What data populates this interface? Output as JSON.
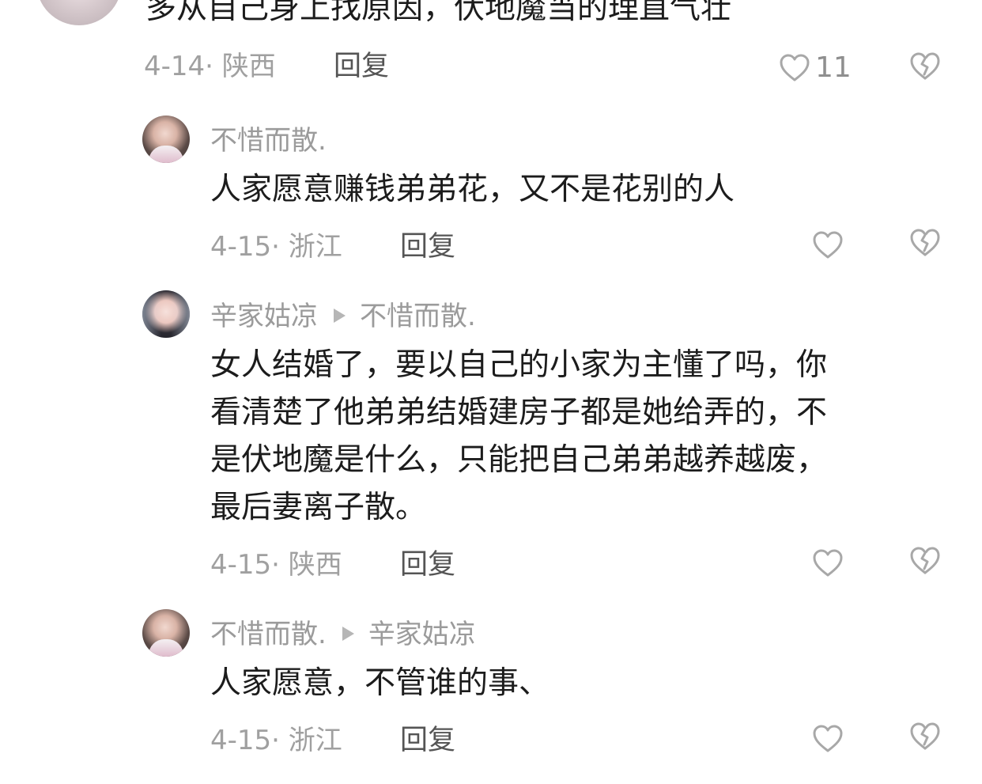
{
  "colors": {
    "primary_text": "#1c1c1c",
    "username": "#9b9b9b",
    "meta": "#a0a0a0",
    "reply": "#555555",
    "icon": "#a8a8a8"
  },
  "top_comment": {
    "text": "多从自己身上找原因，伏地魔当的理直气壮",
    "date": "4-14",
    "location": "陕西",
    "reply_label": "回复",
    "like_count": "11",
    "like_icon": "heart-outline-icon",
    "dislike_icon": "broken-heart-icon"
  },
  "replies": [
    {
      "author": "不惜而散.",
      "reply_to": "",
      "text": "人家愿意赚钱弟弟花，又不是花别的人",
      "date": "4-15",
      "location": "浙江",
      "reply_label": "回复"
    },
    {
      "author": "辛家姑凉",
      "reply_to": "不惜而散.",
      "text_lines": [
        "女人结婚了，要以自己的小家为主懂了吗，你",
        "看清楚了他弟弟结婚建房子都是她给弄的，不",
        "是伏地魔是什么，只能把自己弟弟越养越废，",
        "最后妻离子散。"
      ],
      "date": "4-15",
      "location": "陕西",
      "reply_label": "回复"
    },
    {
      "author": "不惜而散.",
      "reply_to": "辛家姑凉",
      "text": "人家愿意，不管谁的事、",
      "date": "4-15",
      "location": "浙江",
      "reply_label": "回复"
    }
  ]
}
